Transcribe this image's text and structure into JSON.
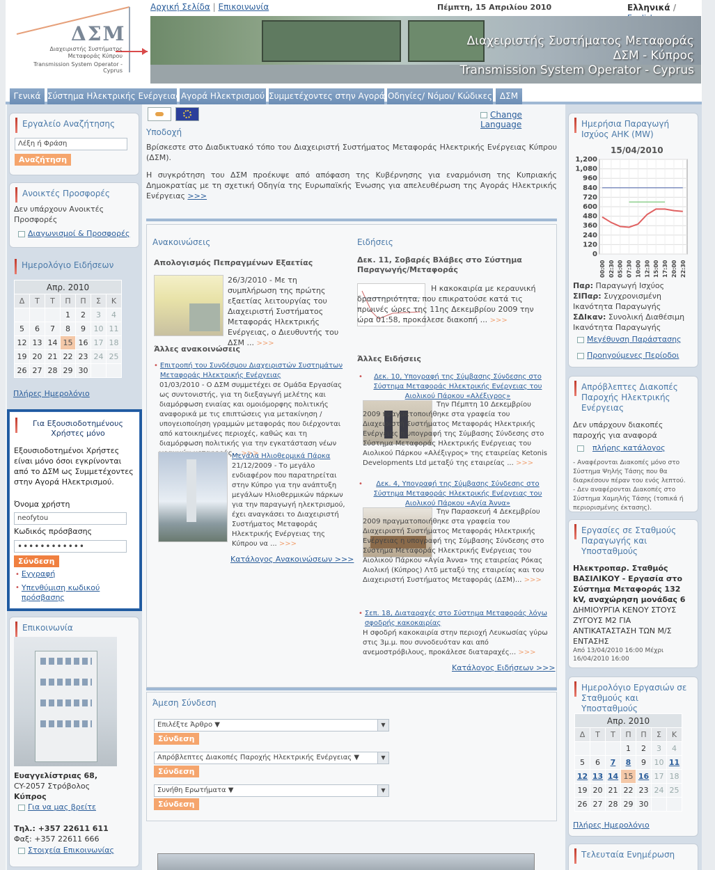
{
  "header": {
    "logo_mark": "ΔΣΜ",
    "logo_gr": "Διαχειριστής Συστήματος Μεταφοράς Κύπρου",
    "logo_en": "Transmission System Operator - Cyprus",
    "links": [
      "Αρχική Σελίδα",
      "Επικοινωνία"
    ],
    "date": "Πέμπτη, 15 Απριλίου 2010",
    "lang_gr": "Ελληνικά",
    "lang_sep": "/",
    "lang_en": "English",
    "banner_lines": [
      "Διαχειριστής Συστήματος Μεταφοράς",
      "ΔΣΜ - Κύπρος",
      "Transmission System Operator  - Cyprus"
    ]
  },
  "nav": [
    "Γενικά",
    "Σύστημα Ηλεκτρικής Ενέργειας",
    "Αγορά Ηλεκτρισμού",
    "Συμμετέχοντες στην Αγορά",
    "Οδηγίες/ Νόμοι/ Κώδικες",
    "ΔΣΜ"
  ],
  "left": {
    "search": {
      "title": "Εργαλείο Αναζήτησης",
      "placeholder": "Λέξη ή Φράση",
      "button": "Αναζήτηση"
    },
    "offers": {
      "title": "Ανοικτές Προσφορές",
      "text": "Δεν υπάρχουν Ανοικτές Προσφορές",
      "link": "Διαγωνισμοί & Προσφορές"
    },
    "calendar": {
      "title": "Ημερολόγιο Ειδήσεων",
      "month": "Απρ. 2010",
      "days": [
        "Δ",
        "Τ",
        "Τ",
        "Π",
        "Π",
        "Σ",
        "Κ"
      ],
      "weeks": [
        [
          "",
          "",
          "",
          "1",
          "2",
          "3",
          "4"
        ],
        [
          "5",
          "6",
          "7",
          "8",
          "9",
          "10",
          "11"
        ],
        [
          "12",
          "13",
          "14",
          "15",
          "16",
          "17",
          "18"
        ],
        [
          "19",
          "20",
          "21",
          "22",
          "23",
          "24",
          "25"
        ],
        [
          "26",
          "27",
          "28",
          "29",
          "30",
          "",
          ""
        ]
      ],
      "link": "Πλήρες Ημερολόγιο"
    },
    "login": {
      "title": "Για Εξουσιοδοτημένους Χρήστες μόνο",
      "text": "Εξουσιοδοτημένοι Χρήστες είναι μόνο όσοι εγκρίνονται από το ΔΣΜ ως Συμμετέχοντες στην Αγορά Ηλεκτρισμού.",
      "user_label": "Όνομα χρήστη",
      "user_value": "neofytou",
      "pass_label": "Κωδικός πρόσβασης",
      "pass_value": "••••••••••••",
      "button": "Σύνδεση",
      "links": [
        "Εγγραφή",
        "Υπενθύμιση κωδικού πρόσβασης"
      ]
    },
    "contact": {
      "title": "Επικοινωνία",
      "address1": "Ευαγγελίστριας 68,",
      "address2": "CY-2057 Στρόβολος",
      "address3": "Κύπρος",
      "link1": "Για να μας βρείτε",
      "tel": "Τηλ.: +357 22611 611",
      "fax": "Φαξ: +357 22611 666",
      "link2": "Στοιχεία Επικοινωνίας"
    }
  },
  "mid": {
    "change_language": "Change Language",
    "welcome": {
      "title": "Υποδοχή",
      "p1": "Βρίσκεστε στο Διαδικτυακό τόπο του Διαχειριστή Συστήματος Μεταφοράς Ηλεκτρικής Ενέργειας Κύπρου (ΔΣΜ).",
      "p2": "Η συγκρότηση του ΔΣΜ προέκυψε από απόφαση της Κυβέρνησης για εναρμόνιση της Κυπριακής Δημοκρατίας με τη σχετική Οδηγία της Ευρωπαϊκής Ένωσης για απελευθέρωση της Αγοράς Ηλεκτρικής Ενέργειας",
      "more": ">>>"
    },
    "announcements": {
      "title": "Ανακοινώσεις",
      "main_title": "Απολογισμός Πεπραγμένων Εξαετίας",
      "main_text": "26/3/2010 - Με τη συμπλήρωση της πρώτης εξαετίας λειτουργίας του Διαχειριστή Συστήματος Μεταφοράς Ηλεκτρικής Ενέργειας, ο Διευθυντής του ΔΣΜ ...",
      "other_title": "Άλλες ανακοινώσεις",
      "item1_link": "Επιτροπή του Συνδέσμου Διαχειριστών Συστημάτων Μεταφοράς Ηλεκτρικής Ενέργειας",
      "item1_text": "01/03/2010 - Ο ΔΣΜ συμμετέχει σε Ομάδα Εργασίας ως συντονιστής, για τη διεξαγωγή μελέτης και διαμόρφωση ενιαίας και ομοιόμορφης πολιτικής αναφορικά με τις επιπτώσεις για μετακίνηση / υπογειοποίηση γραμμών μεταφοράς που διέρχονται από κατοικημένες περιοχές, καθώς και τη διαμόρφωση πολιτικής για την εγκατάσταση νέων γραμμών μεταφοράς...",
      "item2_link": "Μεγάλα Ηλιοθερμικά Πάρκα",
      "item2_text": "21/12/2009 - Το μεγάλο ενδιαφέρον που παρατηρείται στην Κύπρο για την ανάπτυξη μεγάλων Ηλιοθερμικών πάρκων για την παραγωγή ηλεκτρισμού, έχει αναγκάσει το Διαχειριστή Συστήματος Μεταφοράς Ηλεκτρικής Ενέργειας της Κύπρου να ...",
      "catalog": "Κατάλογος Ανακοινώσεων  >>>"
    },
    "news": {
      "title": "Ειδήσεις",
      "main_title": "Δεκ. 11, Σοβαρές Βλάβες στο Σύστημα Παραγωγής/Μεταφοράς",
      "main_text": "Η κακοκαιρία με κεραυνική δραστηριότητα, που επικρατούσε κατά τις πρωινές ώρες της 11ης Δεκεμβρίου 2009 την ώρα 01:58, προκάλεσε διακοπή ...",
      "other_title": "Άλλες Ειδήσεις",
      "n1_link": "Δεκ. 10, Υπογραφή της Σύμβασης Σύνδεσης στο Σύστημα Μεταφοράς Ηλεκτρικής Ενέργειας του Αιολικού Πάρκου «Αλέξιγρος»",
      "n1_text": "Την Πέμπτη 10 Δεκεμβρίου 2009 πραγματοποιήθηκε στα γραφεία του Διαχειριστή Συστήματος Μεταφοράς Ηλεκτρικής Ενέργειας η υπογραφή της Σύμβασης Σύνδεσης στο Σύστημα Μεταφοράς Ηλεκτρικής Ενέργειας του Αιολικού Πάρκου «Αλέξιγρος» της εταιρείας Ketonis Developments Ltd μεταξύ της εταιρείας ...",
      "n2_link": "Δεκ. 4, Υπογραφή της Σύμβασης Σύνδεσης στο Σύστημα Μεταφοράς Ηλεκτρικής Ενέργειας του Αιολικού Πάρκου «Αγία Άννα»",
      "n2_text": "Την Παρασκευή 4 Δεκεμβρίου 2009 πραγματοποιήθηκε στα γραφεία του Διαχειριστή Συστήματος Μεταφοράς Ηλεκτρικής Ενέργειας η υπογραφή της Σύμβασης Σύνδεσης στο Σύστημα Μεταφοράς Ηλεκτρικής Ενέργειας του Αιολικού Πάρκου «Αγία Άννα» της εταιρείας Ρόκας Αιολική (Κύπρος) Λτδ μεταξύ της εταιρείας και του Διαχειριστή Συστήματος Μεταφοράς (ΔΣΜ)...",
      "n3_link": "Σεπ. 18, Διαταραχές στο Σύστημα Μεταφοράς λόγω σφοδρής κακοκαιρίας",
      "n3_text": "Η σφοδρή κακοκαιρία στην περιοχή Λευκωσίας γύρω στις 3μ.μ. που συνοδευόταν και από ανεμοστρόβιλους, προκάλεσε διαταραχές...",
      "catalog": "Κατάλογος Ειδήσεων  >>>"
    },
    "direct": {
      "title": "Άμεση Σύνδεση",
      "sel1": "Επιλέξτε Άρθρο ▼",
      "sel2": "Απρόβλεπτες Διακοπές Παροχής Ηλεκτρικής Ενέργειας ▼",
      "sel3": "Συνήθη Ερωτήματα ▼",
      "button": "Σύνδεση"
    }
  },
  "right": {
    "production": {
      "title": "Ημερήσια Παραγωγή Ισχύος ΑΗΚ (MW)",
      "date": "15/04/2010",
      "legend1_b": "Παρ:",
      "legend1": " Παραγωγή Ισχύος",
      "legend2_b": "ΣΙΠαρ:",
      "legend2": " Συγχρονισμένη Ικανότητα Παραγωγής",
      "legend3_b": "ΣΔΙκαν:",
      "legend3": " Συνολική Διαθέσιμη Ικανότητα Παραγωγής",
      "link1": "Μεγέθυνση Παράστασης",
      "link2": "Προηγούμενες Περίοδοι"
    },
    "outages": {
      "title": "Απρόβλεπτες Διακοπές Παροχής Ηλεκτρικής Ενέργειας",
      "text": "Δεν υπάρχουν διακοπές παροχής για αναφορά",
      "link": "πλήρης κατάλογος",
      "note1": "- Αναφέρονται Διακοπές μόνο στο Σύστημα Ψηλής Τάσης που θα διαρκέσουν πέραν του ενός λεπτού.",
      "note2": "- Δεν αναφέρονται Διακοπές στο Σύστημα Χαμηλής Τάσης (τοπικά ή περιορισμένης έκτασης)."
    },
    "works": {
      "title": "Εργασίες σε Σταθμούς Παραγωγής και Υποσταθμούς",
      "bold": "Ηλεκτροπαρ. Σταθμός ΒΑΣΙΛΙΚΟΥ - Εργασία στο Σύστημα Μεταφοράς 132 kV, αναχώρηση μονάδας 6",
      "text": "ΔΗΜΙΟΥΡΓΙΑ ΚΕΝΟΥ ΣΤΟΥΣ ΖΥΓΟΥΣ Μ2 ΓΙΑ ΑΝΤΙΚΑΤΑΣΤΑΣΗ ΤΩΝ Μ/Σ ΕΝΤΑΣΗΣ",
      "period": "Από 13/04/2010 16:00 Μέχρι 16/04/2010 16:00"
    },
    "workcal": {
      "title": "Ημερολόγιο Εργασιών σε Σταθμούς και Υποσταθμούς",
      "month": "Απρ. 2010",
      "days": [
        "Δ",
        "Τ",
        "Τ",
        "Π",
        "Π",
        "Σ",
        "Κ"
      ],
      "weeks": [
        [
          "",
          "",
          "",
          "1",
          "2",
          "3",
          "4"
        ],
        [
          "5",
          "6",
          "7",
          "8",
          "9",
          "10",
          "11"
        ],
        [
          "12",
          "13",
          "14",
          "15",
          "16",
          "17",
          "18"
        ],
        [
          "19",
          "20",
          "21",
          "22",
          "23",
          "24",
          "25"
        ],
        [
          "26",
          "27",
          "28",
          "29",
          "30",
          "",
          ""
        ]
      ],
      "link": "Πλήρες Ημερολόγιο"
    },
    "update": {
      "title": "Τελευταία Ενημέρωση"
    }
  },
  "chart_data": {
    "type": "line",
    "title": "",
    "ylim": [
      0,
      1200
    ],
    "yticks": [
      0,
      120,
      240,
      360,
      480,
      600,
      720,
      840,
      960,
      1080,
      1200
    ],
    "x": [
      "00:00",
      "02:30",
      "05:00",
      "07:30",
      "10:00",
      "12:30",
      "15:00",
      "17:30",
      "20:00",
      "22:30"
    ],
    "series": [
      {
        "values": [
          840,
          840,
          840,
          840,
          840,
          840,
          840,
          840,
          840,
          840
        ],
        "color": "#7f8fbf"
      },
      {
        "values": [
          null,
          null,
          null,
          660,
          660,
          660,
          660,
          660,
          null,
          null
        ],
        "color": "#8fd08f"
      },
      {
        "values": [
          470,
          400,
          350,
          340,
          380,
          500,
          570,
          570,
          550,
          540
        ],
        "color": "#e06060"
      }
    ]
  },
  "colors": {
    "accent": "#4a79a8",
    "button": "#f5a56d",
    "nav": "#6b8db5"
  }
}
